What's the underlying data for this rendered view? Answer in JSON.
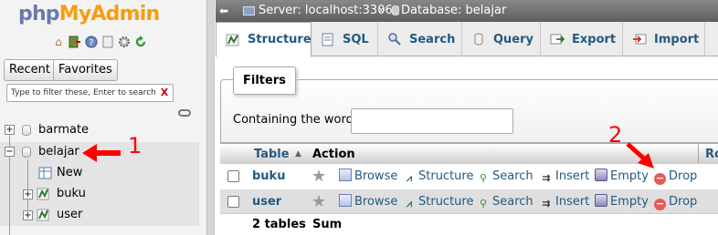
{
  "nav": {
    "logo_part1": "php",
    "logo_part2": "MyAdmin",
    "quick_icons": [
      "home-icon",
      "logout-icon",
      "help-icon",
      "docs-icon",
      "settings-icon",
      "reload-icon"
    ],
    "recent_label": "Recent",
    "favorites_label": "Favorites",
    "filter_placeholder": "Type to filter these, Enter to search all",
    "clear_label": "X",
    "tree": {
      "db1": "barmate",
      "db2": "belajar",
      "new_label": "New",
      "table1": "buku",
      "table2": "user"
    }
  },
  "breadcrumb": {
    "server": "Server: localhost:3306",
    "separator": "»",
    "database": "Database: belajar"
  },
  "tabs": [
    {
      "label": "Structure",
      "icon": "structure-icon",
      "active": true
    },
    {
      "label": "SQL",
      "icon": "sql-icon"
    },
    {
      "label": "Search",
      "icon": "search-icon"
    },
    {
      "label": "Query",
      "icon": "query-icon"
    },
    {
      "label": "Export",
      "icon": "export-icon"
    },
    {
      "label": "Import",
      "icon": "import-icon"
    }
  ],
  "filters": {
    "legend": "Filters",
    "label": "Containing the word:",
    "value": ""
  },
  "table": {
    "headers": {
      "table": "Table",
      "sort_arrow": "▲",
      "action": "Action",
      "rows_partial": "Ro"
    },
    "actions": {
      "browse": "Browse",
      "structure": "Structure",
      "search": "Search",
      "insert": "Insert",
      "empty": "Empty",
      "drop": "Drop"
    },
    "rows": [
      {
        "name": "buku"
      },
      {
        "name": "user"
      }
    ],
    "footer": {
      "count": "2 tables",
      "sum": "Sum"
    }
  },
  "annotations": {
    "step1": "1",
    "step2": "2",
    "color": "#ff0000"
  }
}
